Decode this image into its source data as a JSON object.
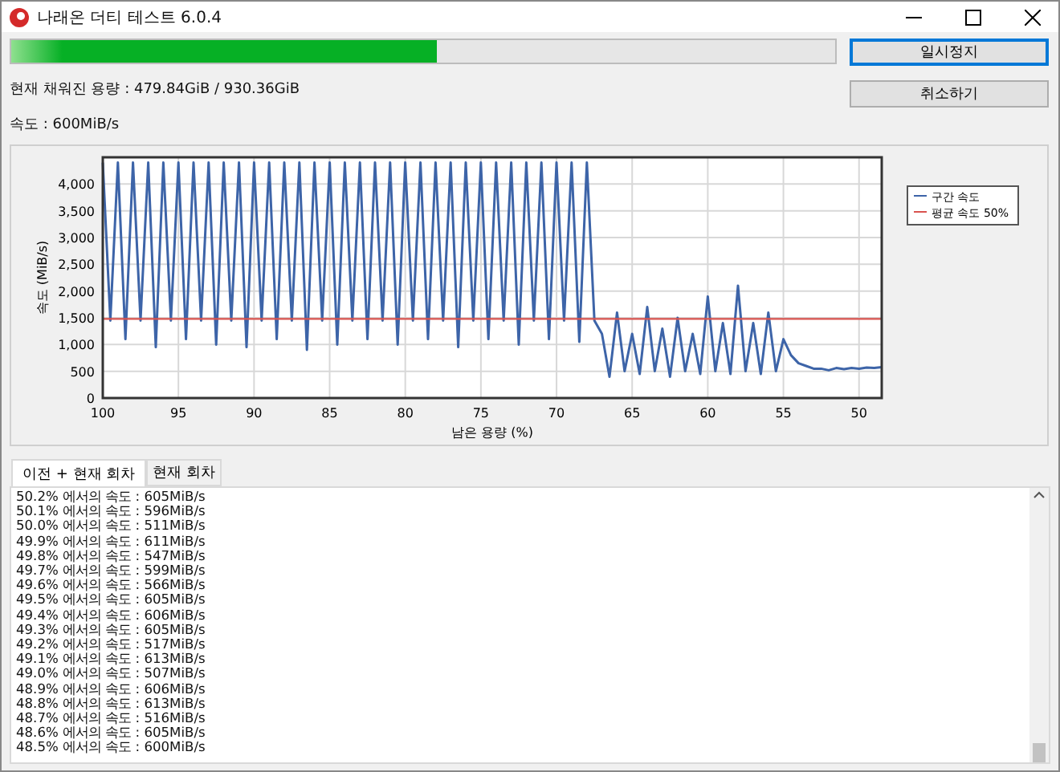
{
  "window": {
    "title": "나래온 더티 테스트 6.0.4"
  },
  "progress": {
    "level": 0.516
  },
  "buttons": [
    {
      "label": "일시정지",
      "focused": true
    },
    {
      "label": "취소하기",
      "focused": false
    }
  ],
  "status": [
    "현재 채워진 용량 : 479.84GiB / 930.36GiB",
    "속도 : 600MiB/s"
  ],
  "chart": {
    "chart_data": {
      "type": "line",
      "grid": true,
      "legend": true,
      "xlabel": "남은 용량 (%)",
      "ylabel": "속도 (MiB/s)",
      "xlim": [
        100,
        48.5
      ],
      "ylim": [
        0,
        4500
      ],
      "xticks": [
        100,
        95,
        90,
        85,
        80,
        75,
        70,
        65,
        60,
        55,
        50
      ],
      "yticks": [
        {
          "value": 0,
          "label": "0"
        },
        {
          "value": 500,
          "label": "500"
        },
        {
          "value": 1000,
          "label": "1,000"
        },
        {
          "value": 1500,
          "label": "1,500"
        },
        {
          "value": 2000,
          "label": "2,000"
        },
        {
          "value": 2500,
          "label": "2,500"
        },
        {
          "value": 3000,
          "label": "3,000"
        },
        {
          "value": 3500,
          "label": "3,500"
        },
        {
          "value": 4000,
          "label": "4,000"
        }
      ],
      "x": [
        100,
        99.5,
        99,
        98.5,
        98,
        97.5,
        97,
        96.5,
        96,
        95.5,
        95,
        94.5,
        94,
        93.5,
        93,
        92.5,
        92,
        91.5,
        91,
        90.5,
        90,
        89.5,
        89,
        88.5,
        88,
        87.5,
        87,
        86.5,
        86,
        85.5,
        85,
        84.5,
        84,
        83.5,
        83,
        82.5,
        82,
        81.5,
        81,
        80.5,
        80,
        79.5,
        79,
        78.5,
        78,
        77.5,
        77,
        76.5,
        76,
        75.5,
        75,
        74.5,
        74,
        73.5,
        73,
        72.5,
        72,
        71.5,
        71,
        70.5,
        70,
        69.5,
        69,
        68.5,
        68,
        67.5,
        67,
        66.5,
        66,
        65.5,
        65,
        64.5,
        64,
        63.5,
        63,
        62.5,
        62,
        61.5,
        61,
        60.5,
        60,
        59.5,
        59,
        58.5,
        58,
        57.5,
        57,
        56.5,
        56,
        55.5,
        55,
        54.5,
        54,
        53.5,
        53,
        52.5,
        52,
        51.5,
        51,
        50.5,
        50,
        49.5,
        49,
        48.5
      ],
      "series": [
        {
          "name": "구간 속도",
          "color": "#3d64a8",
          "values": [
            4400,
            1450,
            4400,
            1100,
            4400,
            1450,
            4400,
            950,
            4400,
            1450,
            4400,
            1100,
            4400,
            1450,
            4400,
            1000,
            4400,
            1450,
            4400,
            950,
            4400,
            1450,
            4400,
            1100,
            4400,
            1450,
            4400,
            900,
            4400,
            1450,
            4400,
            1000,
            4400,
            1450,
            4400,
            1100,
            4400,
            1450,
            4400,
            1000,
            4400,
            1450,
            4400,
            1100,
            4400,
            1450,
            4400,
            950,
            4400,
            1450,
            4400,
            1100,
            4400,
            1450,
            4400,
            1000,
            4400,
            1450,
            4400,
            1100,
            4400,
            1450,
            4400,
            1050,
            4400,
            1450,
            1200,
            400,
            1600,
            500,
            1200,
            450,
            1700,
            500,
            1300,
            400,
            1500,
            500,
            1200,
            450,
            1900,
            500,
            1400,
            450,
            2100,
            500,
            1400,
            450,
            1600,
            500,
            1100,
            800,
            650,
            600,
            550,
            550,
            520,
            560,
            540,
            560,
            550,
            570,
            560,
            580
          ]
        },
        {
          "name": "평균 속도 50%",
          "color": "#d9534f",
          "values": [
            1480,
            null,
            null,
            null,
            null,
            null,
            null,
            null,
            null,
            null,
            null,
            null,
            null,
            null,
            null,
            null,
            null,
            null,
            null,
            null,
            null,
            null,
            null,
            null,
            null,
            null,
            null,
            null,
            null,
            null,
            null,
            null,
            null,
            null,
            null,
            null,
            null,
            null,
            null,
            null,
            null,
            null,
            null,
            null,
            null,
            null,
            null,
            null,
            null,
            null,
            null,
            null,
            null,
            null,
            null,
            null,
            null,
            null,
            null,
            null,
            null,
            null,
            null,
            null,
            null,
            null,
            null,
            null,
            null,
            null,
            null,
            null,
            null,
            null,
            null,
            null,
            null,
            null,
            null,
            null,
            null,
            null,
            null,
            null,
            null,
            null,
            null,
            null,
            null,
            null,
            null,
            null,
            null,
            null,
            null,
            null,
            null,
            null,
            null,
            null,
            null,
            null,
            null,
            1480
          ]
        }
      ]
    }
  },
  "tabs": [
    {
      "label": "이전 + 현재 회차",
      "selected": true
    },
    {
      "label": "현재 회차",
      "selected": false
    }
  ],
  "log": [
    "50.2% 에서의 속도 : 605MiB/s",
    "50.1% 에서의 속도 : 596MiB/s",
    "50.0% 에서의 속도 : 511MiB/s",
    "49.9% 에서의 속도 : 611MiB/s",
    "49.8% 에서의 속도 : 547MiB/s",
    "49.7% 에서의 속도 : 599MiB/s",
    "49.6% 에서의 속도 : 566MiB/s",
    "49.5% 에서의 속도 : 605MiB/s",
    "49.4% 에서의 속도 : 606MiB/s",
    "49.3% 에서의 속도 : 605MiB/s",
    "49.2% 에서의 속도 : 517MiB/s",
    "49.1% 에서의 속도 : 613MiB/s",
    "49.0% 에서의 속도 : 507MiB/s",
    "48.9% 에서의 속도 : 606MiB/s",
    "48.8% 에서의 속도 : 613MiB/s",
    "48.7% 에서의 속도 : 516MiB/s",
    "48.6% 에서의 속도 : 605MiB/s",
    "48.5% 에서의 속도 : 600MiB/s"
  ]
}
